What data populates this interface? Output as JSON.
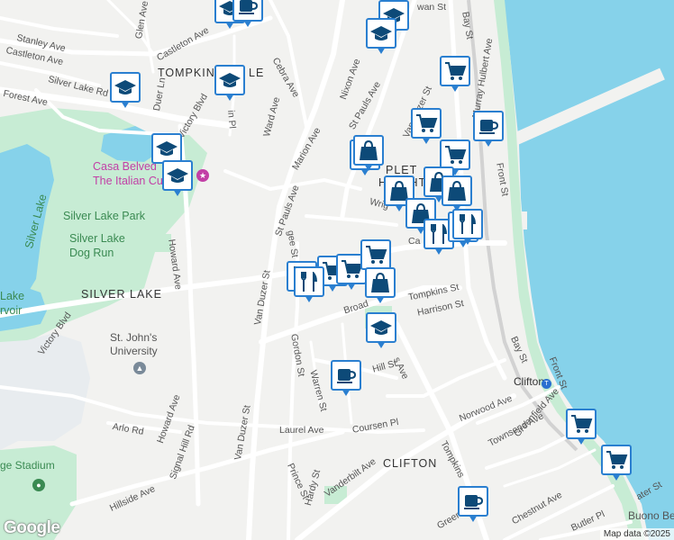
{
  "map": {
    "attribution": "Map data ©2025",
    "logo": "Google",
    "colors": {
      "water": "#86d2ea",
      "park": "#c7ecd4",
      "road": "#ffffff",
      "land": "#f2f2f0",
      "marker_border": "#2a7fd0",
      "marker_icon": "#0d4a78"
    },
    "labels": [
      {
        "id": "label-wan-st",
        "text": "wan St"
      },
      {
        "id": "label-glen-ave",
        "text": "Glen Ave"
      },
      {
        "id": "label-stanley-ave",
        "text": "Stanley Ave"
      },
      {
        "id": "label-castleton-ave-1",
        "text": "Castleton Ave"
      },
      {
        "id": "label-castleton-ave-2",
        "text": "Castleton Ave"
      },
      {
        "id": "label-tompkinsville",
        "text": "TOMPKIN"
      },
      {
        "id": "label-tompkinsville-2",
        "text": "LE"
      },
      {
        "id": "label-cebra-ave",
        "text": "Cebra Ave"
      },
      {
        "id": "label-bay-st-top",
        "text": "Bay St"
      },
      {
        "id": "label-silver-lake-rd",
        "text": "Silver Lake Rd"
      },
      {
        "id": "label-duer-ln",
        "text": "Duer Ln"
      },
      {
        "id": "label-nixon-ave",
        "text": "Nixon Ave"
      },
      {
        "id": "label-st-pauls-ave-top",
        "text": "St Pauls Ave"
      },
      {
        "id": "label-murray-hulbert-ave",
        "text": "Murray Hulbert Ave"
      },
      {
        "id": "label-forest-ave",
        "text": "Forest Ave"
      },
      {
        "id": "label-ward-ave",
        "text": "Ward Ave"
      },
      {
        "id": "label-in-pl",
        "text": "in Pl"
      },
      {
        "id": "label-van-duzer-st-top",
        "text": "Van Duzer St"
      },
      {
        "id": "label-marion-ave",
        "text": "Marion Ave"
      },
      {
        "id": "label-casa-belvedere",
        "text": "Casa Belved"
      },
      {
        "id": "label-italian-cultural",
        "text": "The Italian Cultu"
      },
      {
        "id": "label-appleton-heights",
        "text": "PLET"
      },
      {
        "id": "label-heights",
        "text": "HEIGHT"
      },
      {
        "id": "label-front-st-top",
        "text": "Front St"
      },
      {
        "id": "label-wright",
        "text": "Wrig"
      },
      {
        "id": "label-silver-lake-park",
        "text": "Silver Lake Park"
      },
      {
        "id": "label-silver-lake",
        "text": "Silver Lake"
      },
      {
        "id": "label-st-pauls-ave-mid",
        "text": "St Pauls Ave"
      },
      {
        "id": "label-silver-lake-dog-run",
        "text": "Silver Lake"
      },
      {
        "id": "label-dog-run",
        "text": "Dog Run"
      },
      {
        "id": "label-howard-ave-top",
        "text": "Howard Ave"
      },
      {
        "id": "label-van-duzer-st-mid",
        "text": "Van Duzer St"
      },
      {
        "id": "label-gee-st",
        "text": "gee St"
      },
      {
        "id": "label-ca",
        "text": "Ca"
      },
      {
        "id": "label-silver-lake-area",
        "text": "SILVER LAKE"
      },
      {
        "id": "label-lake",
        "text": "Lake"
      },
      {
        "id": "label-rvoir",
        "text": "rvoir"
      },
      {
        "id": "label-victory-blvd-1",
        "text": "Victory Blvd"
      },
      {
        "id": "label-victory-blvd-2",
        "text": "Victory Blvd"
      },
      {
        "id": "label-broad",
        "text": "Broad"
      },
      {
        "id": "label-tompkins-st",
        "text": "Tompkins St"
      },
      {
        "id": "label-harrison-st",
        "text": "Harrison St"
      },
      {
        "id": "label-st-johns",
        "text": "St. John's"
      },
      {
        "id": "label-university",
        "text": "University"
      },
      {
        "id": "label-gordon-st",
        "text": "Gordon St"
      },
      {
        "id": "label-warren-st",
        "text": "Warren St"
      },
      {
        "id": "label-hill-st",
        "text": "Hill St"
      },
      {
        "id": "label-s-ave",
        "text": "s Ave"
      },
      {
        "id": "label-bay-st-mid",
        "text": "Bay St"
      },
      {
        "id": "label-clifton-station",
        "text": "Clifton"
      },
      {
        "id": "label-front-st-bot",
        "text": "Front St"
      },
      {
        "id": "label-howard-ave-bot",
        "text": "Howard Ave"
      },
      {
        "id": "label-arlo-rd",
        "text": "Arlo Rd"
      },
      {
        "id": "label-laurel-ave",
        "text": "Laurel Ave"
      },
      {
        "id": "label-coursen-pl",
        "text": "Coursen Pl"
      },
      {
        "id": "label-norwood-ave",
        "text": "Norwood Ave"
      },
      {
        "id": "label-townsend-ave",
        "text": "Townsend Ave"
      },
      {
        "id": "label-greenfield-ave-1",
        "text": "Greenfield Ave"
      },
      {
        "id": "label-van-duzer-st-bot",
        "text": "Van Duzer St"
      },
      {
        "id": "label-stadium",
        "text": "ge Stadium"
      },
      {
        "id": "label-signal-hill-rd",
        "text": "Signal Hill Rd"
      },
      {
        "id": "label-prince-st",
        "text": "Prince St"
      },
      {
        "id": "label-vanderbilt-ave",
        "text": "Vanderbilt Ave"
      },
      {
        "id": "label-clifton-area",
        "text": "CLIFTON"
      },
      {
        "id": "label-tompkins-ave",
        "text": "Tompkins"
      },
      {
        "id": "label-hillside-ave",
        "text": "Hillside Ave"
      },
      {
        "id": "label-hardy-st",
        "text": "Hardy St"
      },
      {
        "id": "label-ater-st",
        "text": "ater St"
      },
      {
        "id": "label-greenfield-ave-2",
        "text": "Greenfield A"
      },
      {
        "id": "label-chestnut-ave",
        "text": "Chestnut Ave"
      },
      {
        "id": "label-butler-pl",
        "text": "Butler Pl"
      },
      {
        "id": "label-buono-be",
        "text": "Buono Be"
      }
    ],
    "markers": [
      {
        "type": "graduation-cap"
      },
      {
        "type": "coffee"
      },
      {
        "type": "graduation-cap"
      },
      {
        "type": "graduation-cap"
      },
      {
        "type": "graduation-cap"
      },
      {
        "type": "graduation-cap"
      },
      {
        "type": "graduation-cap"
      },
      {
        "type": "shopping-cart"
      },
      {
        "type": "shopping-cart"
      },
      {
        "type": "coffee"
      },
      {
        "type": "shopping-bag"
      },
      {
        "type": "shopping-bag"
      },
      {
        "type": "shopping-bag"
      },
      {
        "type": "shopping-bag"
      },
      {
        "type": "shopping-cart"
      },
      {
        "type": "shopping-bag"
      },
      {
        "type": "shopping-bag"
      },
      {
        "type": "utensils"
      },
      {
        "type": "utensils"
      },
      {
        "type": "utensils"
      },
      {
        "type": "shopping-cart"
      },
      {
        "type": "utensils"
      },
      {
        "type": "utensils"
      },
      {
        "type": "shopping-cart"
      },
      {
        "type": "shopping-cart"
      },
      {
        "type": "shopping-bag"
      },
      {
        "type": "graduation-cap"
      },
      {
        "type": "graduation-cap"
      },
      {
        "type": "coffee"
      },
      {
        "type": "shopping-cart"
      },
      {
        "type": "coffee"
      },
      {
        "type": "shopping-cart"
      }
    ]
  }
}
